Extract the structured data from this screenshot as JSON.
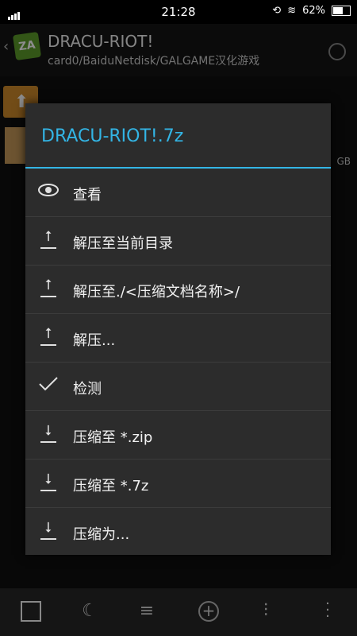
{
  "status_bar": {
    "time": "21:28",
    "battery": "62%",
    "battery_level": 0.62,
    "icons": [
      "signal-icon",
      "rotation-icon",
      "wifi-icon",
      "battery-icon"
    ]
  },
  "app_bar": {
    "title": "DRACU-RIOT!",
    "path": "card0/BaiduNetdisk/GALGAME汉化游戏",
    "logo_text": "ZA",
    "icons": [
      "back-icon",
      "search-icon"
    ]
  },
  "file_list": {
    "rows": [
      {
        "icon": "up-folder-icon"
      },
      {
        "icon": "archive-file-icon",
        "meta": "GB"
      }
    ]
  },
  "dialog": {
    "title": "DRACU-RIOT!.7z",
    "accent_color": "#33b5e5",
    "items": [
      {
        "icon": "eye-icon",
        "label": "查看"
      },
      {
        "icon": "upload-icon",
        "label": "解压至当前目录"
      },
      {
        "icon": "upload-icon",
        "label": "解压至./<压缩文档名称>/"
      },
      {
        "icon": "upload-icon",
        "label": "解压..."
      },
      {
        "icon": "check-icon",
        "label": "检测"
      },
      {
        "icon": "download-icon",
        "label": "压缩至 *.zip"
      },
      {
        "icon": "download-icon",
        "label": "压缩至 *.7z"
      },
      {
        "icon": "download-icon",
        "label": "压缩为..."
      }
    ]
  },
  "bottom_bar": {
    "icons": [
      "grid-icon",
      "night-mode-icon",
      "sort-icon",
      "add-icon",
      "filter-icon",
      "more-icon"
    ]
  }
}
